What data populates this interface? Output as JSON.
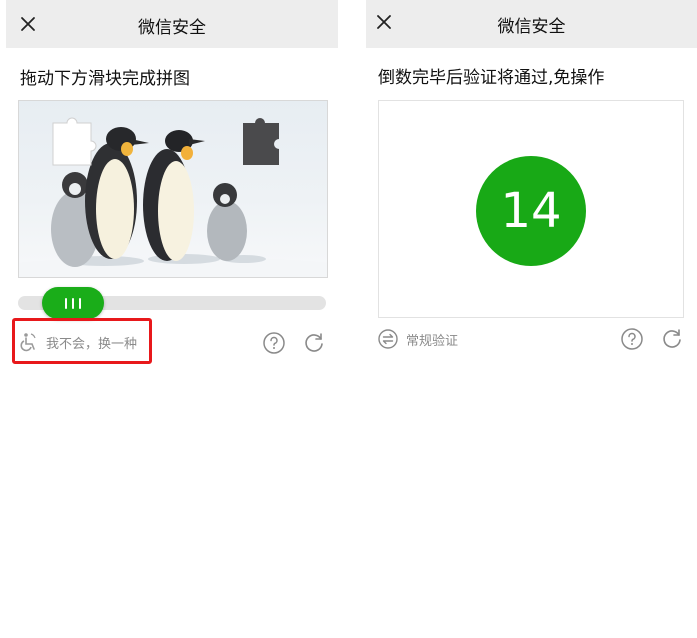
{
  "left": {
    "title": "微信安全",
    "instruction": "拖动下方滑块完成拼图",
    "alt_option": "我不会，换一种",
    "slider_progress": 0.08,
    "icons": {
      "close": "close-icon",
      "accessibility": "wheelchair-icon",
      "help": "question-icon",
      "refresh": "refresh-icon"
    }
  },
  "right": {
    "title": "微信安全",
    "instruction": "倒数完毕后验证将通过,免操作",
    "countdown": "14",
    "normal_verify": "常规验证",
    "icons": {
      "close": "close-icon",
      "switch": "switch-arrows-icon",
      "help": "question-icon",
      "refresh": "refresh-icon"
    }
  },
  "colors": {
    "accent_green": "#1aad19",
    "highlight_red": "#e8181b",
    "titlebar_bg": "#ededed"
  }
}
